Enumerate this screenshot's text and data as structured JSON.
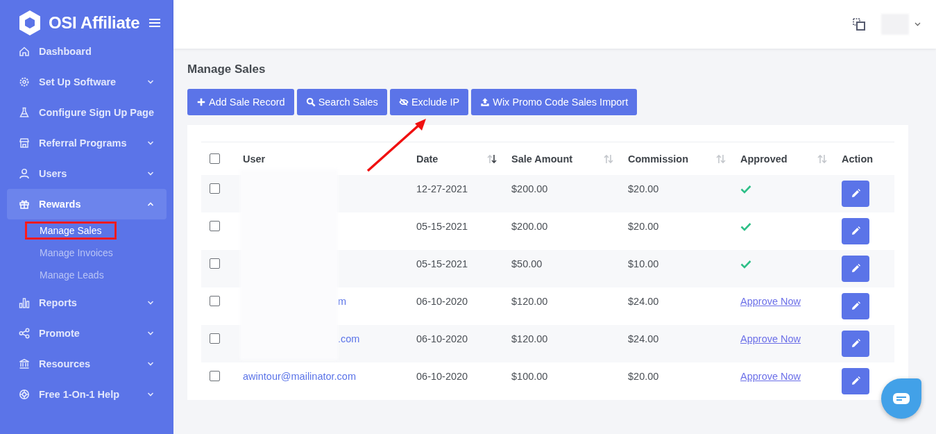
{
  "sidebar": {
    "brand": "OSI Affiliate",
    "items": [
      {
        "label": "Dashboard",
        "selected": false
      },
      {
        "label": "Set Up Software",
        "expanded": false,
        "selected": false
      },
      {
        "label": "Configure Sign Up Page",
        "selected": false
      },
      {
        "label": "Referral Programs",
        "expanded": false,
        "selected": false
      },
      {
        "label": "Users",
        "expanded": false,
        "selected": false
      },
      {
        "label": "Rewards",
        "expanded": true,
        "selected": true,
        "children": [
          {
            "label": "Manage Sales",
            "selected": true,
            "highlighted": true
          },
          {
            "label": "Manage Invoices",
            "selected": false,
            "highlighted": false
          },
          {
            "label": "Manage Leads",
            "selected": false,
            "highlighted": false
          }
        ]
      },
      {
        "label": "Reports",
        "expanded": false,
        "selected": false
      },
      {
        "label": "Promote",
        "expanded": false,
        "selected": false
      },
      {
        "label": "Resources",
        "expanded": false,
        "selected": false
      },
      {
        "label": "Free 1-On-1 Help",
        "expanded": false,
        "selected": false
      }
    ]
  },
  "page_title": "Manage Sales",
  "toolbar": [
    "Add Sale Record",
    "Search Sales",
    "Exclude IP",
    "Wix Promo Code Sales Import"
  ],
  "table": {
    "select_all_checked": false,
    "columns": [
      {
        "label": "User"
      },
      {
        "label": "Date",
        "sorted": true
      },
      {
        "label": "Sale Amount",
        "sorted": false
      },
      {
        "label": "Commission",
        "sorted": false
      },
      {
        "label": "Approved",
        "sorted": false
      },
      {
        "label": "Action"
      }
    ],
    "rows": [
      {
        "checked": false,
        "date": "12-27-2021",
        "sale_amount": "$200.00",
        "commission": "$20.00",
        "approved": true
      },
      {
        "checked": false,
        "date": "05-15-2021",
        "sale_amount": "$200.00",
        "commission": "$20.00",
        "approved": true
      },
      {
        "checked": false,
        "date": "05-15-2021",
        "sale_amount": "$50.00",
        "commission": "$10.00",
        "approved": true
      },
      {
        "checked": false,
        "user": "m",
        "date": "06-10-2020",
        "sale_amount": "$120.00",
        "commission": "$24.00",
        "approved": false,
        "approve_link": "Approve Now"
      },
      {
        "checked": false,
        "user": ".com",
        "date": "06-10-2020",
        "sale_amount": "$120.00",
        "commission": "$24.00",
        "approved": false,
        "approve_link": "Approve Now"
      },
      {
        "checked": false,
        "user": "awintour@mailinator.com",
        "date": "06-10-2020",
        "sale_amount": "$100.00",
        "commission": "$20.00",
        "approved": false,
        "approve_link": "Approve Now"
      }
    ]
  }
}
